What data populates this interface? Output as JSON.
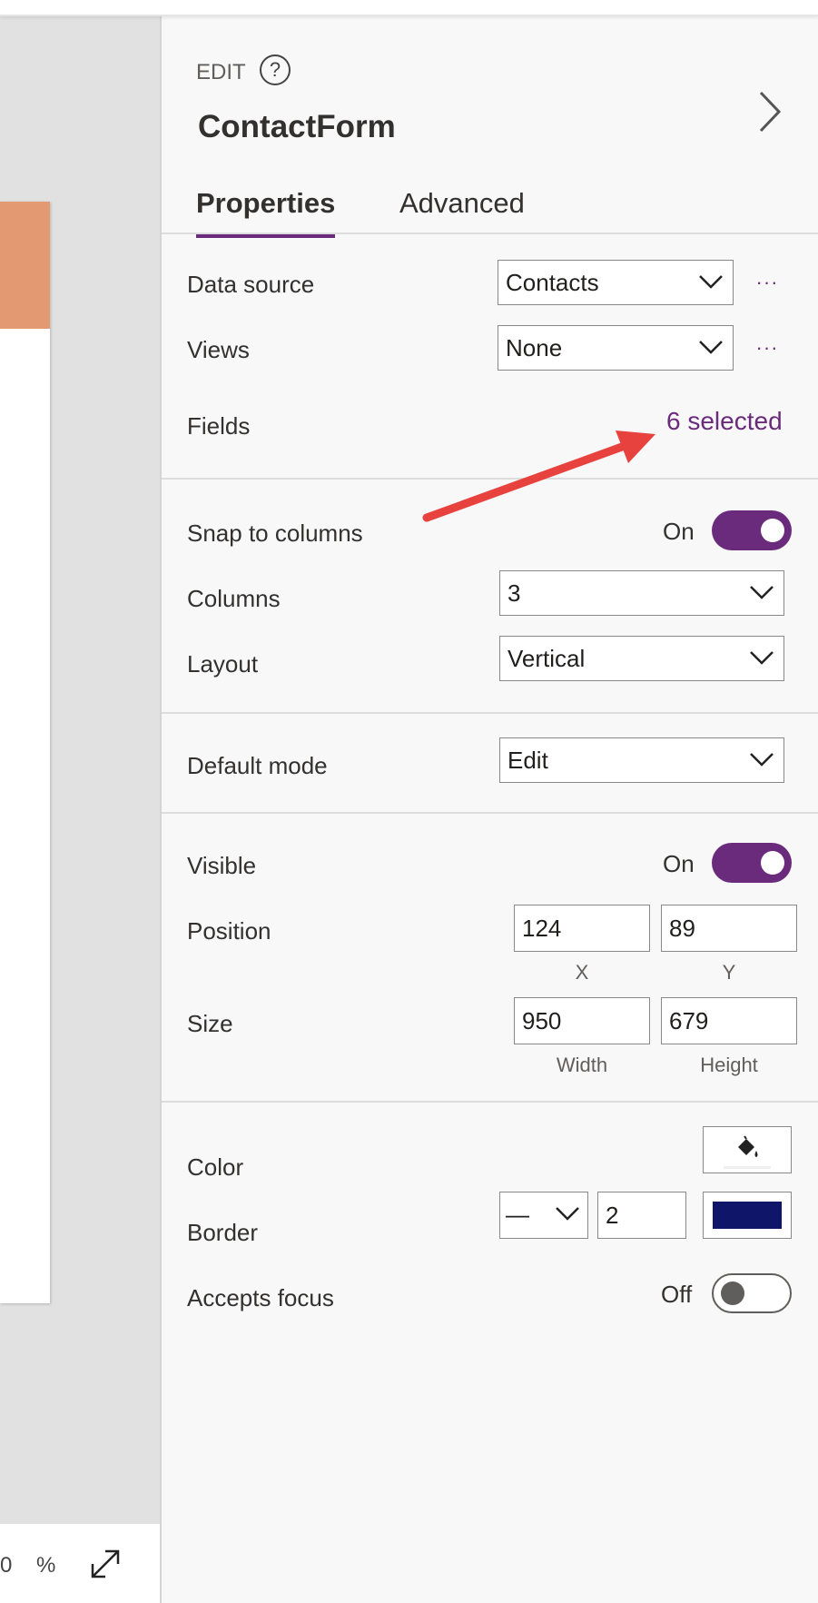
{
  "canvas": {
    "zoom_text": "0 %",
    "card_header_color": "#e39a73",
    "icons": {
      "expand": "expand-diagonal-icon"
    }
  },
  "panel": {
    "edit_label": "EDIT",
    "help_symbol": "?",
    "control_name": "ContactForm",
    "tabs": [
      {
        "label": "Properties",
        "active": true
      },
      {
        "label": "Advanced",
        "active": false
      }
    ],
    "data_source": {
      "label": "Data source",
      "value": "Contacts",
      "more": "···"
    },
    "views": {
      "label": "Views",
      "value": "None",
      "more": "···"
    },
    "fields": {
      "label": "Fields",
      "value": "6 selected"
    },
    "snap_to_columns": {
      "label": "Snap to columns",
      "state": "On"
    },
    "columns": {
      "label": "Columns",
      "value": "3"
    },
    "layout": {
      "label": "Layout",
      "value": "Vertical"
    },
    "default_mode": {
      "label": "Default mode",
      "value": "Edit"
    },
    "visible": {
      "label": "Visible",
      "state": "On"
    },
    "position": {
      "label": "Position",
      "x": "124",
      "y": "89",
      "x_caption": "X",
      "y_caption": "Y"
    },
    "size": {
      "label": "Size",
      "width": "950",
      "height": "679",
      "width_caption": "Width",
      "height_caption": "Height"
    },
    "color": {
      "label": "Color",
      "icon": "paint-bucket-icon"
    },
    "border": {
      "label": "Border",
      "style": "—",
      "thickness": "2",
      "color": "#0f1569"
    },
    "accepts_focus": {
      "label": "Accepts focus",
      "state": "Off"
    },
    "accent_color": "#6b2b7c"
  },
  "annotation": {
    "arrow_color": "#e8423f"
  }
}
